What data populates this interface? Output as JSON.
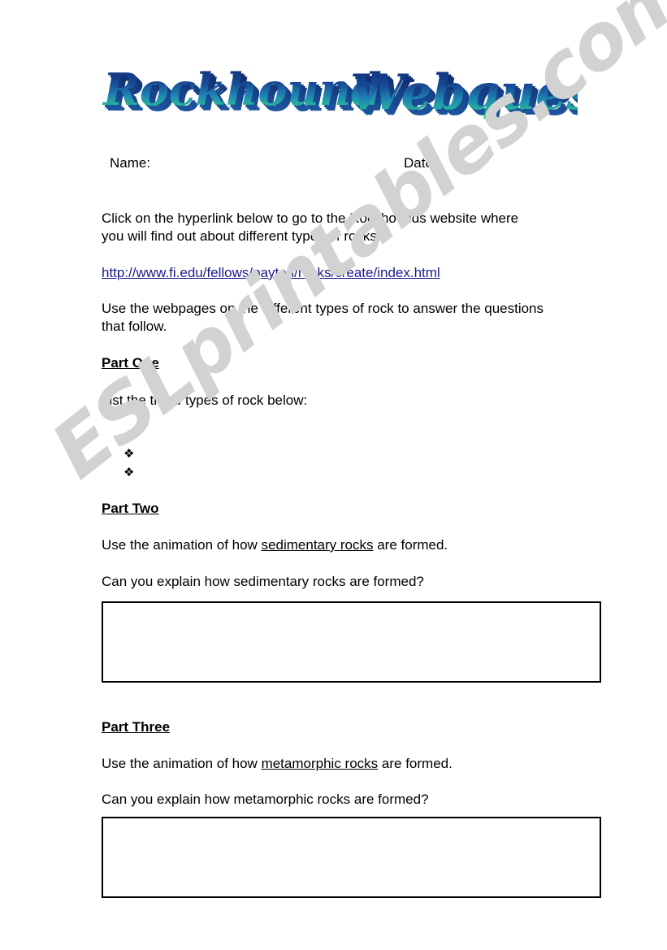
{
  "document": {
    "title": "Rockhound Webquest",
    "title_word_1": "Rockhound",
    "title_word_2": "Webquest",
    "title_gradient_top": "#12307e",
    "title_gradient_bottom": "#2ee07a",
    "title_extrude_color": "#1c58a8"
  },
  "watermark": {
    "text": "ESLprintables.com",
    "color": "#d2d2d2"
  },
  "fields": {
    "name_label": "Name:",
    "date_label": "Date:"
  },
  "body": {
    "intro": "Click on the hyperlink below to go to the Rockhounds website where you will find out about different types of rocks.",
    "link_text": "http://www.fi.edu/fellows/payton/rocks/create/index.html",
    "link_color": "#1a1a8c",
    "instruction": "Use the webpages on the different types of rock to answer the questions that follow."
  },
  "sections": [
    {
      "heading": "Part One",
      "prompt": "List the three types of rock below:",
      "bullets": [
        "",
        "",
        ""
      ],
      "bullet_glyph": "❖"
    },
    {
      "heading": "Part Two",
      "animation_line_before": "Use the animation of how ",
      "animation_link": "sedimentary rocks",
      "animation_line_after": " are formed.",
      "question": "Can you explain how sedimentary rocks are formed?",
      "answer": ""
    },
    {
      "heading": "Part Three",
      "animation_line_before": "Use the animation of how ",
      "animation_link": "metamorphic rocks",
      "animation_line_after": " are formed.",
      "question": "Can you explain how metamorphic rocks are formed?",
      "answer": ""
    }
  ]
}
